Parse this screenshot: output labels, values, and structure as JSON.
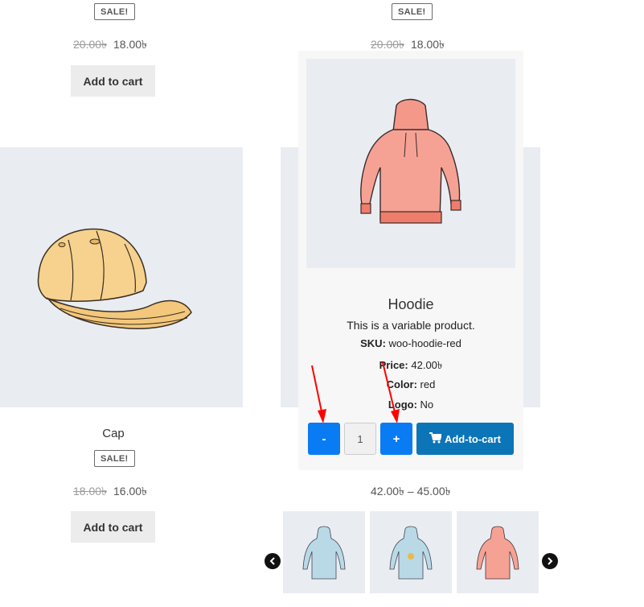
{
  "top_left": {
    "badge": "SALE!",
    "old_price": "20.00৳",
    "price": "18.00৳",
    "button": "Add to cart"
  },
  "top_right": {
    "badge": "SALE!",
    "old_price": "20.00৳",
    "price": "18.00৳"
  },
  "cap": {
    "title": "Cap",
    "badge": "SALE!",
    "old_price": "18.00৳",
    "price": "16.00৳",
    "button": "Add to cart"
  },
  "popup": {
    "close": "×",
    "title": "Hoodie",
    "description": "This is a variable product.",
    "sku_label": "SKU:",
    "sku_value": "woo-hoodie-red",
    "price_label": "Price:",
    "price_value": "42.00৳",
    "color_label": "Color:",
    "color_value": "red",
    "logo_label": "Logo:",
    "logo_value": "No",
    "minus": "-",
    "qty": "1",
    "plus": "+",
    "add_to_cart": "Add-to-cart",
    "cart_icon": "cart-icon"
  },
  "hoodie_range_price": "42.00৳ – 45.00৳",
  "colors": {
    "accent_blue": "#0a7cf3",
    "cart_blue": "#0b75b8",
    "arrow_red": "#ff0000",
    "image_bg": "#e9edf2"
  }
}
